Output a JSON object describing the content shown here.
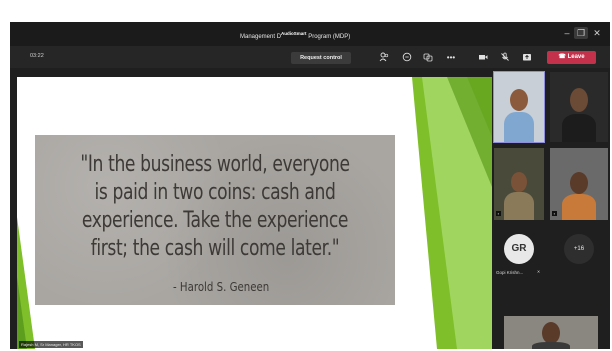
{
  "window": {
    "title": "Management D",
    "title_overlay": "AudioSmart",
    "title_suffix": " Program (MDP)",
    "controls": [
      "–",
      "❐",
      "✕"
    ]
  },
  "toolbar": {
    "timer": "03:22",
    "request_control_label": "Request control",
    "leave_label": "Leave",
    "icons": [
      "participants-icon",
      "chat-icon",
      "reactions-icon",
      "more-options-icon",
      "camera-icon",
      "mic-off-icon",
      "share-icon"
    ]
  },
  "slide": {
    "quote": "\"In the business world, everyone is paid in two coins: cash and experience. Take the experience first; the cash will come later.\"",
    "author": "- Harold S. Geneen"
  },
  "presenter_label": "Rajesh M, Sr Manager, HR TKOS",
  "participants": {
    "gr_initials": "GR",
    "gr_name": "Gopi Krishn...",
    "more_count": "+16"
  },
  "colors": {
    "leave": "#c4314b",
    "green_accent": "#7fbf2a",
    "active_outline": "#8e8edb"
  }
}
